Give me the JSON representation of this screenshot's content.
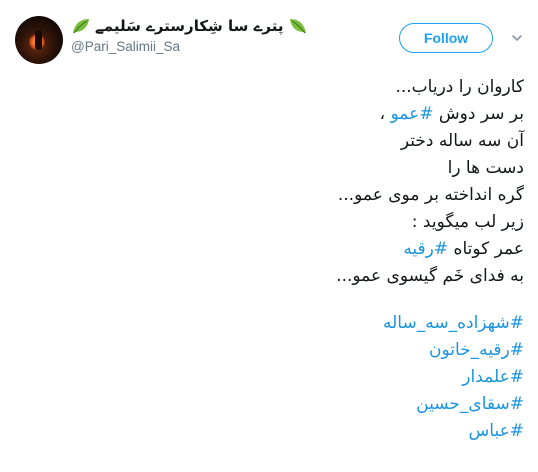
{
  "user": {
    "display_name": "پترے سا شِکارسترے سَلیمے",
    "handle": "@Pari_Salimii_Sa"
  },
  "follow_label": "Follow",
  "tweet": {
    "line1": "کاروان را دریاب...",
    "line2_pre": "بر سر دوش ",
    "line2_tag": "#عمو",
    "line2_post": " ،",
    "line3": "آن سه ساله دختر",
    "line4": "دست ها را",
    "line5": "گره انداخته بر موی عمو...",
    "line6": "زیر لب میگوید :",
    "line7_pre": "عمر کوتاه ",
    "line7_tag": "#رقیه",
    "line8": "به فدای خَم گیسوی عمو...",
    "hashtags": [
      "#شهزاده_سه_ساله",
      "#رقیه_خاتون",
      "#علمدار",
      "#سقای_حسین",
      "#عباس"
    ]
  },
  "colors": {
    "accent": "#1da1f2",
    "link": "#1b95e0",
    "text": "#14171a",
    "muted": "#657786"
  },
  "icons": {
    "name_decoration": "leaf-icon",
    "more": "chevron-down-icon"
  }
}
